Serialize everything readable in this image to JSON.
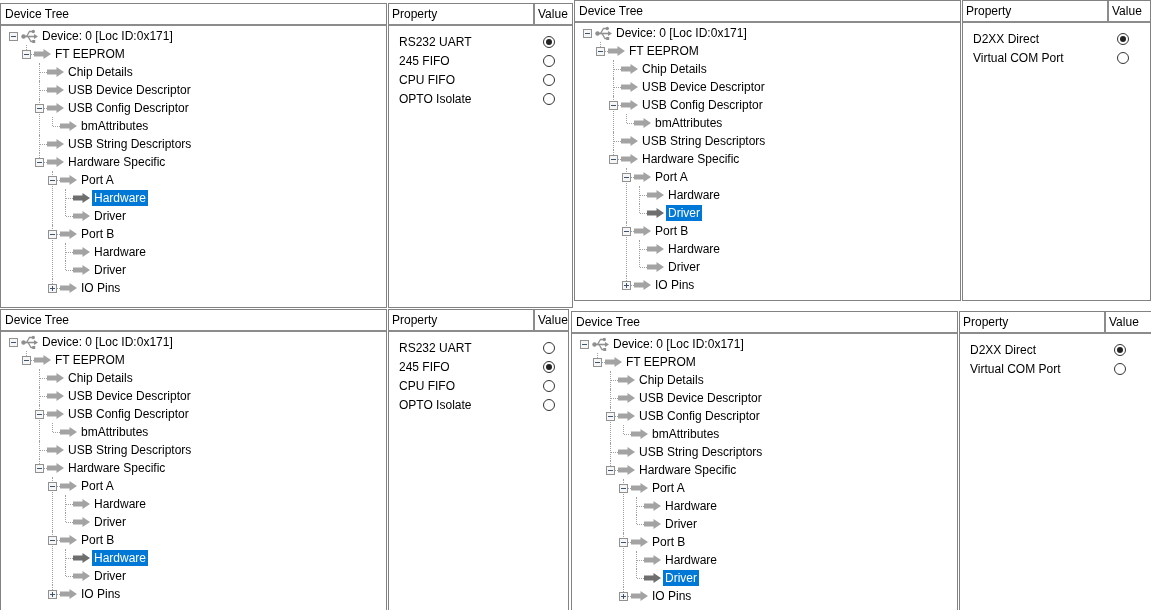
{
  "panels": [
    {
      "tree": {
        "header": "Device Tree",
        "items": [
          {
            "kind": "device",
            "label": "Device: 0 [Loc ID:0x171]",
            "expanded": true,
            "selected": false,
            "children": [
              {
                "kind": "node",
                "label": "FT EEPROM",
                "expanded": true,
                "selected": false,
                "children": [
                  {
                    "kind": "node",
                    "label": "Chip Details",
                    "selected": false
                  },
                  {
                    "kind": "node",
                    "label": "USB Device Descriptor",
                    "selected": false
                  },
                  {
                    "kind": "node",
                    "label": "USB Config Descriptor",
                    "expanded": true,
                    "selected": false,
                    "children": [
                      {
                        "kind": "node",
                        "label": "bmAttributes",
                        "selected": false
                      }
                    ]
                  },
                  {
                    "kind": "node",
                    "label": "USB String Descriptors",
                    "selected": false
                  },
                  {
                    "kind": "node",
                    "label": "Hardware Specific",
                    "expanded": true,
                    "selected": false,
                    "children": [
                      {
                        "kind": "node",
                        "label": "Port A",
                        "expanded": true,
                        "selected": false,
                        "children": [
                          {
                            "kind": "node",
                            "label": "Hardware",
                            "selected": true
                          },
                          {
                            "kind": "node",
                            "label": "Driver",
                            "selected": false
                          }
                        ]
                      },
                      {
                        "kind": "node",
                        "label": "Port B",
                        "expanded": true,
                        "selected": false,
                        "children": [
                          {
                            "kind": "node",
                            "label": "Hardware",
                            "selected": false
                          },
                          {
                            "kind": "node",
                            "label": "Driver",
                            "selected": false
                          }
                        ]
                      },
                      {
                        "kind": "node",
                        "label": "IO Pins",
                        "expanded": false,
                        "selected": false
                      }
                    ]
                  }
                ]
              }
            ]
          }
        ]
      },
      "properties": {
        "columns": [
          "Property",
          "Value"
        ],
        "rows": [
          {
            "label": "RS232 UART",
            "selected": true
          },
          {
            "label": "245 FIFO",
            "selected": false
          },
          {
            "label": "CPU FIFO",
            "selected": false
          },
          {
            "label": "OPTO Isolate",
            "selected": false
          }
        ]
      }
    },
    {
      "tree": {
        "header": "Device Tree",
        "items": [
          {
            "kind": "device",
            "label": "Device: 0 [Loc ID:0x171]",
            "expanded": true,
            "selected": false,
            "children": [
              {
                "kind": "node",
                "label": "FT EEPROM",
                "expanded": true,
                "selected": false,
                "children": [
                  {
                    "kind": "node",
                    "label": "Chip Details",
                    "selected": false
                  },
                  {
                    "kind": "node",
                    "label": "USB Device Descriptor",
                    "selected": false
                  },
                  {
                    "kind": "node",
                    "label": "USB Config Descriptor",
                    "expanded": true,
                    "selected": false,
                    "children": [
                      {
                        "kind": "node",
                        "label": "bmAttributes",
                        "selected": false
                      }
                    ]
                  },
                  {
                    "kind": "node",
                    "label": "USB String Descriptors",
                    "selected": false
                  },
                  {
                    "kind": "node",
                    "label": "Hardware Specific",
                    "expanded": true,
                    "selected": false,
                    "children": [
                      {
                        "kind": "node",
                        "label": "Port A",
                        "expanded": true,
                        "selected": false,
                        "children": [
                          {
                            "kind": "node",
                            "label": "Hardware",
                            "selected": false
                          },
                          {
                            "kind": "node",
                            "label": "Driver",
                            "selected": true
                          }
                        ]
                      },
                      {
                        "kind": "node",
                        "label": "Port B",
                        "expanded": true,
                        "selected": false,
                        "children": [
                          {
                            "kind": "node",
                            "label": "Hardware",
                            "selected": false
                          },
                          {
                            "kind": "node",
                            "label": "Driver",
                            "selected": false
                          }
                        ]
                      },
                      {
                        "kind": "node",
                        "label": "IO Pins",
                        "expanded": false,
                        "selected": false
                      }
                    ]
                  }
                ]
              }
            ]
          }
        ]
      },
      "properties": {
        "columns": [
          "Property",
          "Value"
        ],
        "rows": [
          {
            "label": "D2XX Direct",
            "selected": true
          },
          {
            "label": "Virtual COM Port",
            "selected": false
          }
        ]
      }
    },
    {
      "tree": {
        "header": "Device Tree",
        "items": [
          {
            "kind": "device",
            "label": "Device: 0 [Loc ID:0x171]",
            "expanded": true,
            "selected": false,
            "children": [
              {
                "kind": "node",
                "label": "FT EEPROM",
                "expanded": true,
                "selected": false,
                "children": [
                  {
                    "kind": "node",
                    "label": "Chip Details",
                    "selected": false
                  },
                  {
                    "kind": "node",
                    "label": "USB Device Descriptor",
                    "selected": false
                  },
                  {
                    "kind": "node",
                    "label": "USB Config Descriptor",
                    "expanded": true,
                    "selected": false,
                    "children": [
                      {
                        "kind": "node",
                        "label": "bmAttributes",
                        "selected": false
                      }
                    ]
                  },
                  {
                    "kind": "node",
                    "label": "USB String Descriptors",
                    "selected": false
                  },
                  {
                    "kind": "node",
                    "label": "Hardware Specific",
                    "expanded": true,
                    "selected": false,
                    "children": [
                      {
                        "kind": "node",
                        "label": "Port A",
                        "expanded": true,
                        "selected": false,
                        "children": [
                          {
                            "kind": "node",
                            "label": "Hardware",
                            "selected": false
                          },
                          {
                            "kind": "node",
                            "label": "Driver",
                            "selected": false
                          }
                        ]
                      },
                      {
                        "kind": "node",
                        "label": "Port B",
                        "expanded": true,
                        "selected": false,
                        "children": [
                          {
                            "kind": "node",
                            "label": "Hardware",
                            "selected": true
                          },
                          {
                            "kind": "node",
                            "label": "Driver",
                            "selected": false
                          }
                        ]
                      },
                      {
                        "kind": "node",
                        "label": "IO Pins",
                        "expanded": false,
                        "selected": false
                      }
                    ]
                  }
                ]
              }
            ]
          }
        ]
      },
      "properties": {
        "columns": [
          "Property",
          "Value"
        ],
        "rows": [
          {
            "label": "RS232 UART",
            "selected": false
          },
          {
            "label": "245 FIFO",
            "selected": true
          },
          {
            "label": "CPU FIFO",
            "selected": false
          },
          {
            "label": "OPTO Isolate",
            "selected": false
          }
        ]
      }
    },
    {
      "tree": {
        "header": "Device Tree",
        "items": [
          {
            "kind": "device",
            "label": "Device: 0 [Loc ID:0x171]",
            "expanded": true,
            "selected": false,
            "children": [
              {
                "kind": "node",
                "label": "FT EEPROM",
                "expanded": true,
                "selected": false,
                "children": [
                  {
                    "kind": "node",
                    "label": "Chip Details",
                    "selected": false
                  },
                  {
                    "kind": "node",
                    "label": "USB Device Descriptor",
                    "selected": false
                  },
                  {
                    "kind": "node",
                    "label": "USB Config Descriptor",
                    "expanded": true,
                    "selected": false,
                    "children": [
                      {
                        "kind": "node",
                        "label": "bmAttributes",
                        "selected": false
                      }
                    ]
                  },
                  {
                    "kind": "node",
                    "label": "USB String Descriptors",
                    "selected": false
                  },
                  {
                    "kind": "node",
                    "label": "Hardware Specific",
                    "expanded": true,
                    "selected": false,
                    "children": [
                      {
                        "kind": "node",
                        "label": "Port A",
                        "expanded": true,
                        "selected": false,
                        "children": [
                          {
                            "kind": "node",
                            "label": "Hardware",
                            "selected": false
                          },
                          {
                            "kind": "node",
                            "label": "Driver",
                            "selected": false
                          }
                        ]
                      },
                      {
                        "kind": "node",
                        "label": "Port B",
                        "expanded": true,
                        "selected": false,
                        "children": [
                          {
                            "kind": "node",
                            "label": "Hardware",
                            "selected": false
                          },
                          {
                            "kind": "node",
                            "label": "Driver",
                            "selected": true
                          }
                        ]
                      },
                      {
                        "kind": "node",
                        "label": "IO Pins",
                        "expanded": false,
                        "selected": false
                      }
                    ]
                  }
                ]
              }
            ]
          }
        ]
      },
      "properties": {
        "columns": [
          "Property",
          "Value"
        ],
        "rows": [
          {
            "label": "D2XX Direct",
            "selected": true
          },
          {
            "label": "Virtual COM Port",
            "selected": false
          }
        ]
      }
    }
  ]
}
